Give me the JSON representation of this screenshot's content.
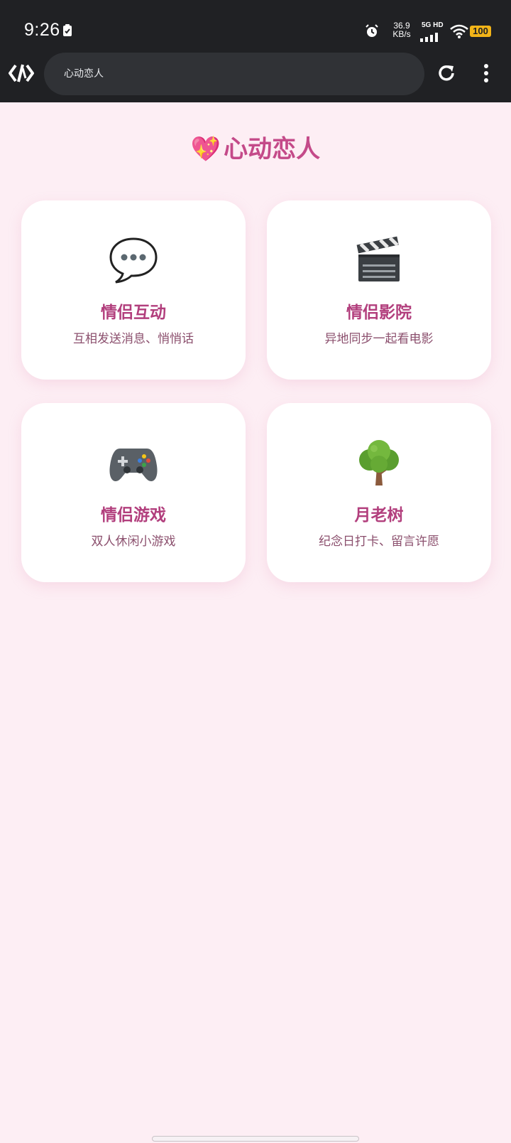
{
  "status_bar": {
    "time": "9:26",
    "speed_value": "36.9",
    "speed_unit": "KB/s",
    "network": "5G HD",
    "battery": "100"
  },
  "browser": {
    "address": "心动恋人",
    "icons": [
      "logo-icon",
      "reload-icon",
      "more-vert-icon"
    ]
  },
  "page": {
    "title_emoji": "💖",
    "title": "心动恋人"
  },
  "cards": [
    {
      "icon": "💬",
      "icon_name": "speech-bubble-icon",
      "title": "情侣互动",
      "desc": "互相发送消息、悄悄话"
    },
    {
      "icon": "🎬",
      "icon_name": "clapperboard-icon",
      "title": "情侣影院",
      "desc": "异地同步一起看电影"
    },
    {
      "icon": "🎮",
      "icon_name": "game-controller-icon",
      "title": "情侣游戏",
      "desc": "双人休闲小游戏"
    },
    {
      "icon": "🌳",
      "icon_name": "tree-icon",
      "title": "月老树",
      "desc": "纪念日打卡、留言许愿"
    }
  ],
  "colors": {
    "background": "#fdeef4",
    "accent": "#c44a89",
    "card_title": "#b23f7d",
    "card_desc": "#8b4f6d"
  }
}
